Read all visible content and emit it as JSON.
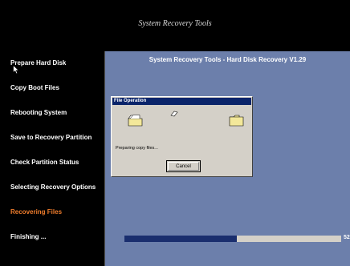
{
  "header": {
    "title": "System Recovery Tools"
  },
  "sidebar": {
    "steps": [
      {
        "label": "Prepare Hard Disk"
      },
      {
        "label": "Copy Boot Files"
      },
      {
        "label": "Rebooting System"
      },
      {
        "label": "Save to Recovery Partition"
      },
      {
        "label": "Check Partition Status"
      },
      {
        "label": "Selecting Recovery Options"
      },
      {
        "label": "Recovering Files",
        "active": true
      },
      {
        "label": "Finishing ..."
      }
    ]
  },
  "main": {
    "title": "System Recovery Tools - Hard Disk Recovery V1.29"
  },
  "dialog": {
    "title": "File Operation",
    "status": "Preparing copy files...",
    "cancel_label": "Cancel",
    "source_icon": "folder-icon",
    "target_icon": "folder-icon",
    "flying_icon": "document-icon"
  },
  "progress": {
    "percent": 52,
    "text": "52"
  },
  "colors": {
    "main_background": "#6c7fab",
    "active_step": "#f07d2c",
    "progress_fill": "#1a2e6e",
    "titlebar": "#0a246a"
  }
}
